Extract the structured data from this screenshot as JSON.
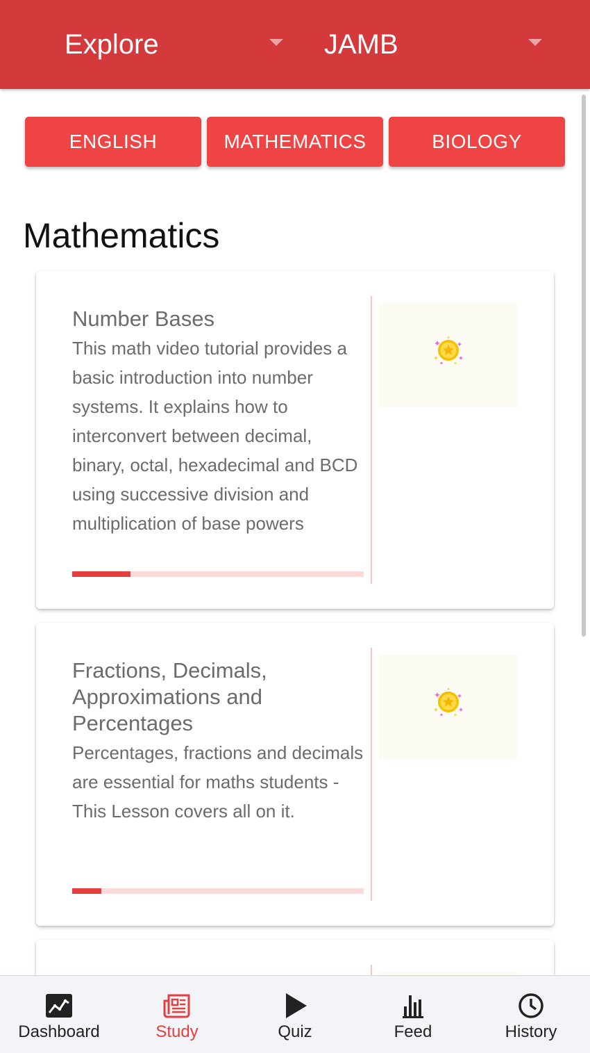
{
  "header": {
    "explore_label": "Explore",
    "exam_label": "JAMB"
  },
  "subjects": [
    {
      "label": "ENGLISH"
    },
    {
      "label": "MATHEMATICS"
    },
    {
      "label": "BIOLOGY"
    }
  ],
  "section_title": "Mathematics",
  "lessons": [
    {
      "title": "Number Bases",
      "description": "This math video tutorial provides a basic introduction into number systems. It explains how to interconvert between decimal, binary, octal, hexadecimal and BCD using successive division and multiplication of base powers",
      "progress": 0.2,
      "thumbnail_icon": "star-coin-icon"
    },
    {
      "title": "Fractions, Decimals, Approximations and Percentages",
      "description": "Percentages, fractions and decimals are essential for maths students - This Lesson covers all on it.",
      "progress": 0.1,
      "thumbnail_icon": "star-coin-icon"
    }
  ],
  "bottom_nav": [
    {
      "label": "Dashboard",
      "icon": "chart-line-icon",
      "active": false
    },
    {
      "label": "Study",
      "icon": "newspaper-icon",
      "active": true
    },
    {
      "label": "Quiz",
      "icon": "play-icon",
      "active": false
    },
    {
      "label": "Feed",
      "icon": "bar-chart-icon",
      "active": false
    },
    {
      "label": "History",
      "icon": "clock-icon",
      "active": false
    }
  ],
  "colors": {
    "primary": "#d4393b",
    "button": "#ef4444",
    "active_nav": "#e53e3e",
    "progress_track": "#fbd9d8"
  }
}
